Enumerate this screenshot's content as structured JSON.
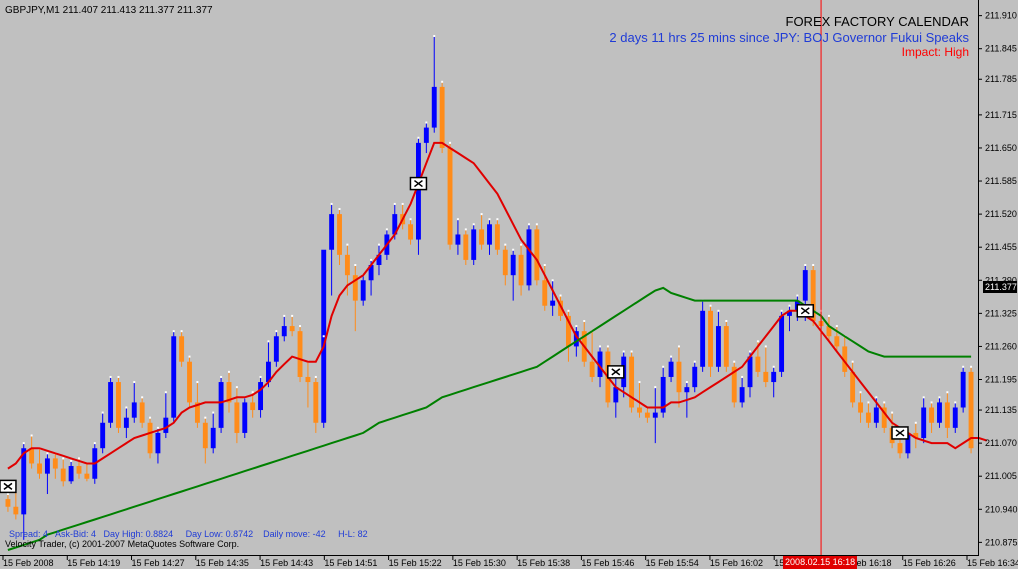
{
  "header": {
    "symbol_info": "GBPJPY,M1  211.407 211.413 211.377 211.377"
  },
  "calendar": {
    "title": "FOREX FACTORY CALENDAR",
    "event": "2 days 11 hrs 25 mins since JPY: BOJ Governor Fukui Speaks",
    "impact": "Impact: High"
  },
  "footer": {
    "stats": "Spread: 4   Ask-Bid: 4   Day High: 0.8824     Day Low: 0.8742    Daily move: -42     H-L: 82",
    "copyright": "Velocity Trader, (c) 2001-2007 MetaQuotes Software Corp."
  },
  "colors": {
    "background": "#c0c0c0",
    "bull": "#0000ff",
    "bear": "#ff8c1a",
    "fast_ma": "#e00000",
    "slow_ma": "#008000",
    "transition_ma": "#800080",
    "grid_axis": "#000000",
    "calendar_line": "#ff0000"
  },
  "price_axis": {
    "ticks": [
      "211.910",
      "211.845",
      "211.785",
      "211.715",
      "211.650",
      "211.585",
      "211.520",
      "211.455",
      "211.390",
      "211.325",
      "211.260",
      "211.195",
      "211.135",
      "211.070",
      "211.005",
      "210.940",
      "210.875"
    ],
    "current_price": "211.377"
  },
  "time_axis": {
    "labels": [
      "15 Feb 2008",
      "15 Feb 14:19",
      "15 Feb 14:27",
      "15 Feb 14:35",
      "15 Feb 14:43",
      "15 Feb 14:51",
      "15 Feb 15:22",
      "15 Feb 15:30",
      "15 Feb 15:38",
      "15 Feb 15:46",
      "15 Feb 15:54",
      "15 Feb 16:02",
      "15 Feb 16:10",
      "15 Feb 16:18",
      "15 Feb 16:26",
      "15 Feb 16:34"
    ],
    "event_time": "2008.02.15 16:18"
  },
  "chart_data": {
    "type": "candlestick",
    "symbol": "GBPJPY",
    "timeframe": "M1",
    "ylim": [
      210.86,
      211.925
    ],
    "grid": false,
    "candles": [
      [
        210.96,
        210.97,
        210.935,
        210.945
      ],
      [
        210.945,
        210.975,
        210.92,
        210.93
      ],
      [
        210.93,
        211.07,
        210.88,
        211.06
      ],
      [
        211.06,
        211.085,
        211.02,
        211.03
      ],
      [
        211.03,
        211.06,
        211.0,
        211.01
      ],
      [
        211.01,
        211.05,
        210.97,
        211.04
      ],
      [
        211.04,
        211.05,
        211.0,
        211.02
      ],
      [
        211.02,
        211.04,
        210.985,
        210.995
      ],
      [
        210.995,
        211.035,
        210.99,
        211.025
      ],
      [
        211.025,
        211.04,
        211.0,
        211.01
      ],
      [
        211.01,
        211.03,
        210.995,
        211.0
      ],
      [
        211.0,
        211.07,
        210.99,
        211.06
      ],
      [
        211.06,
        211.13,
        211.05,
        211.11
      ],
      [
        211.11,
        211.2,
        211.1,
        211.19
      ],
      [
        211.19,
        211.2,
        211.09,
        211.1
      ],
      [
        211.1,
        211.14,
        211.08,
        211.12
      ],
      [
        211.12,
        211.19,
        211.11,
        211.15
      ],
      [
        211.15,
        211.16,
        211.1,
        211.11
      ],
      [
        211.11,
        211.12,
        211.04,
        211.05
      ],
      [
        211.05,
        211.1,
        211.03,
        211.09
      ],
      [
        211.09,
        211.17,
        211.08,
        211.12
      ],
      [
        211.12,
        211.29,
        211.11,
        211.28
      ],
      [
        211.28,
        211.29,
        211.22,
        211.23
      ],
      [
        211.23,
        211.24,
        211.14,
        211.15
      ],
      [
        211.15,
        211.19,
        211.1,
        211.11
      ],
      [
        211.11,
        211.12,
        211.03,
        211.06
      ],
      [
        211.06,
        211.13,
        211.05,
        211.1
      ],
      [
        211.1,
        211.2,
        211.09,
        211.19
      ],
      [
        211.19,
        211.21,
        211.13,
        211.15
      ],
      [
        211.15,
        211.18,
        211.07,
        211.09
      ],
      [
        211.09,
        211.16,
        211.08,
        211.15
      ],
      [
        211.15,
        211.17,
        211.12,
        211.135
      ],
      [
        211.135,
        211.2,
        211.12,
        211.19
      ],
      [
        211.19,
        211.27,
        211.18,
        211.23
      ],
      [
        211.23,
        211.29,
        211.22,
        211.28
      ],
      [
        211.28,
        211.32,
        211.27,
        211.3
      ],
      [
        211.3,
        211.32,
        211.28,
        211.29
      ],
      [
        211.29,
        211.3,
        211.19,
        211.2
      ],
      [
        211.2,
        211.23,
        211.14,
        211.19
      ],
      [
        211.19,
        211.2,
        211.09,
        211.11
      ],
      [
        211.11,
        211.28,
        211.1,
        211.45
      ],
      [
        211.45,
        211.54,
        211.36,
        211.52
      ],
      [
        211.52,
        211.53,
        211.42,
        211.44
      ],
      [
        211.44,
        211.46,
        211.36,
        211.4
      ],
      [
        211.4,
        211.42,
        211.29,
        211.35
      ],
      [
        211.35,
        211.4,
        211.34,
        211.39
      ],
      [
        211.39,
        211.43,
        211.36,
        211.42
      ],
      [
        211.42,
        211.46,
        211.4,
        211.44
      ],
      [
        211.44,
        211.49,
        211.43,
        211.48
      ],
      [
        211.48,
        211.54,
        211.47,
        211.52
      ],
      [
        211.52,
        211.54,
        211.49,
        211.5
      ],
      [
        211.5,
        211.51,
        211.46,
        211.47
      ],
      [
        211.47,
        211.67,
        211.44,
        211.66
      ],
      [
        211.66,
        211.7,
        211.64,
        211.69
      ],
      [
        211.69,
        211.87,
        211.68,
        211.77
      ],
      [
        211.77,
        211.78,
        211.64,
        211.65
      ],
      [
        211.65,
        211.66,
        211.45,
        211.46
      ],
      [
        211.46,
        211.51,
        211.44,
        211.48
      ],
      [
        211.48,
        211.49,
        211.42,
        211.43
      ],
      [
        211.43,
        211.5,
        211.42,
        211.49
      ],
      [
        211.49,
        211.52,
        211.45,
        211.46
      ],
      [
        211.46,
        211.51,
        211.44,
        211.5
      ],
      [
        211.5,
        211.51,
        211.44,
        211.45
      ],
      [
        211.45,
        211.46,
        211.38,
        211.4
      ],
      [
        211.4,
        211.45,
        211.35,
        211.44
      ],
      [
        211.44,
        211.46,
        211.36,
        211.38
      ],
      [
        211.38,
        211.5,
        211.37,
        211.49
      ],
      [
        211.49,
        211.5,
        211.38,
        211.39
      ],
      [
        211.39,
        211.42,
        211.33,
        211.34
      ],
      [
        211.34,
        211.39,
        211.32,
        211.35
      ],
      [
        211.35,
        211.36,
        211.31,
        211.32
      ],
      [
        211.32,
        211.33,
        211.23,
        211.26
      ],
      [
        211.26,
        211.3,
        211.24,
        211.29
      ],
      [
        211.29,
        211.31,
        211.22,
        211.23
      ],
      [
        211.23,
        211.29,
        211.19,
        211.2
      ],
      [
        211.2,
        211.26,
        211.18,
        211.25
      ],
      [
        211.25,
        211.26,
        211.14,
        211.15
      ],
      [
        211.15,
        211.2,
        211.12,
        211.18
      ],
      [
        211.18,
        211.25,
        211.16,
        211.24
      ],
      [
        211.24,
        211.25,
        211.13,
        211.14
      ],
      [
        211.14,
        211.19,
        211.12,
        211.13
      ],
      [
        211.13,
        211.14,
        211.11,
        211.12
      ],
      [
        211.12,
        211.18,
        211.07,
        211.13
      ],
      [
        211.13,
        211.22,
        211.12,
        211.2
      ],
      [
        211.2,
        211.24,
        211.19,
        211.23
      ],
      [
        211.23,
        211.26,
        211.14,
        211.17
      ],
      [
        211.17,
        211.19,
        211.12,
        211.18
      ],
      [
        211.18,
        211.23,
        211.17,
        211.22
      ],
      [
        211.22,
        211.35,
        211.21,
        211.33
      ],
      [
        211.33,
        211.34,
        211.2,
        211.22
      ],
      [
        211.22,
        211.33,
        211.21,
        211.3
      ],
      [
        211.3,
        211.31,
        211.21,
        211.22
      ],
      [
        211.22,
        211.23,
        211.14,
        211.15
      ],
      [
        211.15,
        211.2,
        211.14,
        211.18
      ],
      [
        211.18,
        211.25,
        211.16,
        211.24
      ],
      [
        211.24,
        211.27,
        211.2,
        211.21
      ],
      [
        211.21,
        211.26,
        211.18,
        211.19
      ],
      [
        211.19,
        211.22,
        211.16,
        211.21
      ],
      [
        211.21,
        211.33,
        211.2,
        211.32
      ],
      [
        211.32,
        211.34,
        211.29,
        211.33
      ],
      [
        211.33,
        211.36,
        211.31,
        211.35
      ],
      [
        211.35,
        211.42,
        211.31,
        211.41
      ],
      [
        211.41,
        211.42,
        211.3,
        211.31
      ],
      [
        211.31,
        211.33,
        211.28,
        211.3
      ],
      [
        211.3,
        211.32,
        211.27,
        211.28
      ],
      [
        211.28,
        211.3,
        211.25,
        211.26
      ],
      [
        211.26,
        211.28,
        211.2,
        211.21
      ],
      [
        211.21,
        211.23,
        211.14,
        211.15
      ],
      [
        211.15,
        211.17,
        211.11,
        211.13
      ],
      [
        211.13,
        211.15,
        211.1,
        211.11
      ],
      [
        211.11,
        211.16,
        211.1,
        211.14
      ],
      [
        211.14,
        211.15,
        211.09,
        211.1
      ],
      [
        211.1,
        211.13,
        211.06,
        211.07
      ],
      [
        211.07,
        211.09,
        211.04,
        211.05
      ],
      [
        211.05,
        211.1,
        211.04,
        211.09
      ],
      [
        211.09,
        211.11,
        211.06,
        211.08
      ],
      [
        211.08,
        211.16,
        211.07,
        211.14
      ],
      [
        211.14,
        211.15,
        211.09,
        211.11
      ],
      [
        211.11,
        211.16,
        211.1,
        211.15
      ],
      [
        211.15,
        211.17,
        211.08,
        211.1
      ],
      [
        211.1,
        211.15,
        211.09,
        211.14
      ],
      [
        211.14,
        211.22,
        211.13,
        211.21
      ],
      [
        211.21,
        211.22,
        211.05,
        211.06
      ]
    ],
    "moving_averages": [
      {
        "name": "fast",
        "color": "#e00000",
        "values": [
          211.02,
          211.03,
          211.05,
          211.06,
          211.06,
          211.055,
          211.05,
          211.045,
          211.04,
          211.035,
          211.03,
          211.03,
          211.04,
          211.05,
          211.06,
          211.07,
          211.08,
          211.085,
          211.09,
          211.095,
          211.1,
          211.11,
          211.13,
          211.14,
          211.145,
          211.15,
          211.15,
          211.15,
          211.155,
          211.16,
          211.16,
          211.165,
          211.175,
          211.19,
          211.21,
          211.225,
          211.24,
          211.235,
          211.23,
          211.23,
          211.26,
          211.32,
          211.36,
          211.38,
          211.39,
          211.4,
          211.42,
          211.44,
          211.46,
          211.48,
          211.51,
          211.54,
          211.58,
          211.62,
          211.66,
          211.66,
          211.65,
          211.64,
          211.63,
          211.62,
          211.6,
          211.58,
          211.56,
          211.53,
          211.5,
          211.47,
          211.45,
          211.43,
          211.4,
          211.37,
          211.34,
          211.31,
          211.28,
          211.26,
          211.24,
          211.22,
          211.2,
          211.18,
          211.17,
          211.16,
          211.15,
          211.14,
          211.14,
          211.14,
          211.15,
          211.15,
          211.155,
          211.16,
          211.17,
          211.18,
          211.19,
          211.2,
          211.21,
          211.22,
          211.24,
          211.26,
          211.28,
          211.3,
          211.32,
          211.33,
          211.33,
          211.32,
          211.31,
          211.29,
          211.27,
          211.25,
          211.23,
          211.21,
          211.19,
          211.17,
          211.15,
          211.13,
          211.11,
          211.1,
          211.09,
          211.08,
          211.075,
          211.07,
          211.07,
          211.07,
          211.06,
          211.07,
          211.08,
          211.08,
          211.075
        ]
      },
      {
        "name": "slow",
        "color": "#008000",
        "values": [
          210.86,
          210.865,
          210.87,
          210.875,
          210.88,
          210.89,
          210.895,
          210.9,
          210.905,
          210.91,
          210.915,
          210.92,
          210.925,
          210.93,
          210.935,
          210.94,
          210.945,
          210.95,
          210.955,
          210.96,
          210.965,
          210.97,
          210.975,
          210.98,
          210.985,
          210.99,
          210.995,
          211.0,
          211.005,
          211.01,
          211.015,
          211.02,
          211.025,
          211.03,
          211.035,
          211.04,
          211.045,
          211.05,
          211.055,
          211.06,
          211.065,
          211.07,
          211.075,
          211.08,
          211.085,
          211.09,
          211.1,
          211.11,
          211.115,
          211.12,
          211.125,
          211.13,
          211.135,
          211.14,
          211.15,
          211.16,
          211.165,
          211.17,
          211.175,
          211.18,
          211.185,
          211.19,
          211.195,
          211.2,
          211.205,
          211.21,
          211.215,
          211.22,
          211.23,
          211.24,
          211.25,
          211.26,
          211.27,
          211.28,
          211.29,
          211.3,
          211.31,
          211.32,
          211.33,
          211.34,
          211.35,
          211.36,
          211.37,
          211.375,
          211.365,
          211.36,
          211.355,
          211.35,
          211.35,
          211.35,
          211.35,
          211.35,
          211.35,
          211.35,
          211.35,
          211.35,
          211.35,
          211.35,
          211.35,
          211.35,
          211.35,
          211.34,
          211.33,
          211.32,
          211.3,
          211.29,
          211.28,
          211.27,
          211.26,
          211.25,
          211.245,
          211.24,
          211.24,
          211.24,
          211.24,
          211.24,
          211.24,
          211.24,
          211.24,
          211.24,
          211.24,
          211.24,
          211.24
        ]
      }
    ],
    "markers": [
      {
        "index": 0,
        "price": 210.985
      },
      {
        "index": 52,
        "price": 211.58
      },
      {
        "index": 77,
        "price": 211.21
      },
      {
        "index": 101,
        "price": 211.33
      },
      {
        "index": 113,
        "price": 211.09
      }
    ],
    "event_index": 103
  }
}
